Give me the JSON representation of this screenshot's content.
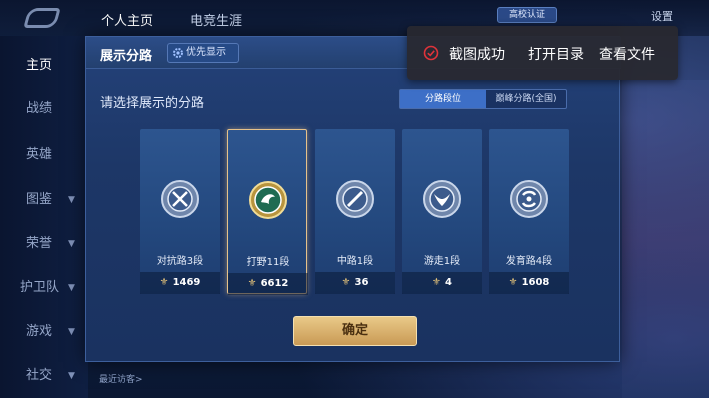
{
  "top_tabs": [
    "个人主页",
    "电竞生涯"
  ],
  "top_right": {
    "campus_badge": "高校认证",
    "settings": "设置"
  },
  "sidebar": {
    "items": [
      {
        "label": "主页",
        "active": true,
        "expandable": false
      },
      {
        "label": "战绩",
        "active": false,
        "expandable": false
      },
      {
        "label": "英雄",
        "active": false,
        "expandable": false
      },
      {
        "label": "图鉴",
        "active": false,
        "expandable": true
      },
      {
        "label": "荣誉",
        "active": false,
        "expandable": true
      },
      {
        "label": "护卫队",
        "active": false,
        "expandable": true
      },
      {
        "label": "游戏",
        "active": false,
        "expandable": true
      },
      {
        "label": "社交",
        "active": false,
        "expandable": true
      }
    ]
  },
  "modal": {
    "title": "展示分路",
    "priority_button": "优先显示",
    "prompt": "请选择展示的分路",
    "toggle": {
      "on": "分路段位",
      "off": "巅峰分路(全国)"
    },
    "lanes": [
      {
        "label": "对抗路3段",
        "points": "1469",
        "selected": false
      },
      {
        "label": "打野11段",
        "points": "6612",
        "selected": true
      },
      {
        "label": "中路1段",
        "points": "36",
        "selected": false
      },
      {
        "label": "游走1段",
        "points": "4",
        "selected": false
      },
      {
        "label": "发育路4段",
        "points": "1608",
        "selected": false
      }
    ],
    "confirm_label": "确定"
  },
  "bottom_hint": "最近访客>",
  "toast": {
    "message": "截图成功",
    "action_open_dir": "打开目录",
    "action_view_file": "查看文件",
    "icon": "check-circle-icon",
    "icon_color": "#e0333a"
  }
}
